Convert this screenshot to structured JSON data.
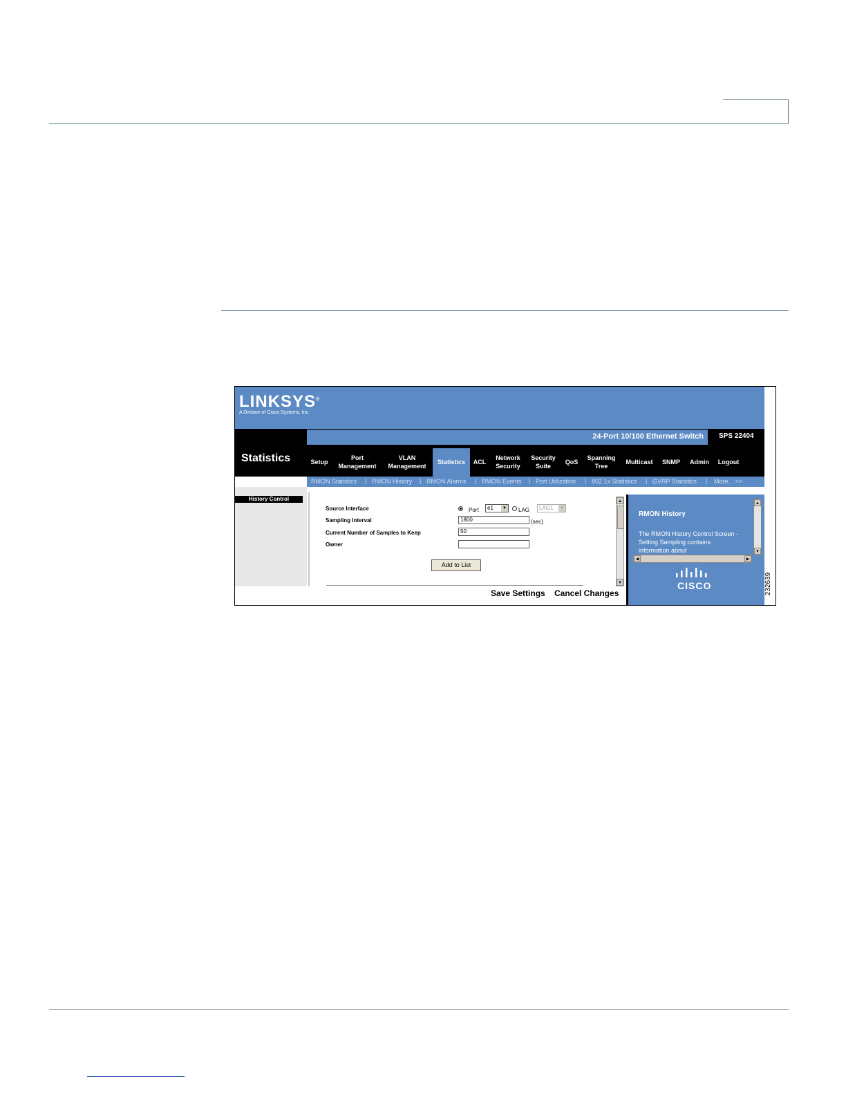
{
  "app": {
    "brand": "LINKSYS",
    "brand_mark": "®",
    "brand_sub": "A Division of Cisco Systems, Inc.",
    "product": "24-Port 10/100 Ethernet Switch",
    "model": "SPS 22404",
    "section_title": "Statistics"
  },
  "nav": {
    "tabs": [
      {
        "label": "Setup"
      },
      {
        "label": "Port\nManagement"
      },
      {
        "label": "VLAN\nManagement"
      },
      {
        "label": "Statistics"
      },
      {
        "label": "ACL"
      },
      {
        "label": "Network\nSecurity"
      },
      {
        "label": "Security\nSuite"
      },
      {
        "label": "QoS"
      },
      {
        "label": "Spanning\nTree"
      },
      {
        "label": "Multicast"
      },
      {
        "label": "SNMP"
      },
      {
        "label": "Admin"
      },
      {
        "label": "Logout"
      }
    ],
    "active_tab": "Statistics",
    "sublinks": [
      "RMON Statistics",
      "RMON History",
      "RMON Alarms",
      "RMON Events",
      "Port Utilization",
      "802.1x Statistics",
      "GVRP Statistics",
      "More... >>"
    ],
    "separator": "|"
  },
  "sidebar": {
    "history_control": "History Control"
  },
  "form": {
    "source_interface_label": "Source Interface",
    "port_option": "Port",
    "port_value": "e1",
    "lag_option": "LAG",
    "lag_value": "LAG1",
    "sampling_interval_label": "Sampling Interval",
    "sampling_interval_value": "1800",
    "sampling_unit": "(sec)",
    "samples_label": "Current Number of Samples to Keep",
    "samples_value": "50",
    "owner_label": "Owner",
    "owner_value": "",
    "add_button": "Add to List",
    "save_button": "Save Settings",
    "cancel_button": "Cancel Changes"
  },
  "help": {
    "title": "RMON History",
    "text": "The RMON History Control Screen - Setting Sampling contains information about",
    "cisco_word": "CISCO"
  },
  "figure_number": "232639",
  "colors": {
    "linksys_blue": "#5b8ac4",
    "black_bar": "#000000",
    "rule": "#7f9aa6"
  },
  "icons": {
    "dropdown_arrow": "▼",
    "scroll_up": "▲",
    "scroll_down": "▼",
    "scroll_left": "◀",
    "scroll_right": "▶"
  }
}
